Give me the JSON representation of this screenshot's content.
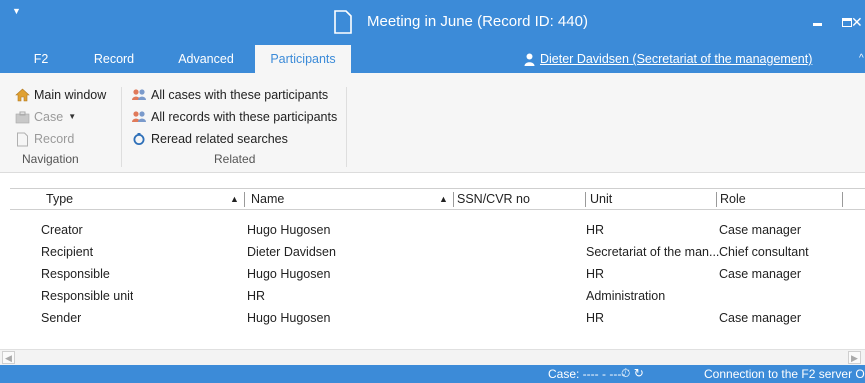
{
  "window": {
    "title": "Meeting in June (Record ID: 440)"
  },
  "tabs": [
    {
      "label": "F2"
    },
    {
      "label": "Record"
    },
    {
      "label": "Advanced"
    },
    {
      "label": "Participants",
      "active": true
    }
  ],
  "user": {
    "label": "Dieter Davidsen (Secretariat of the management)"
  },
  "ribbon": {
    "navigation": {
      "main_window": "Main window",
      "case": "Case",
      "record": "Record",
      "group_label": "Navigation"
    },
    "related": {
      "all_cases": "All cases with these participants",
      "all_records": "All records with these participants",
      "reread": "Reread related searches",
      "group_label": "Related"
    }
  },
  "grid": {
    "columns": [
      "Type",
      "Name",
      "SSN/CVR no",
      "Unit",
      "Role"
    ],
    "rows": [
      {
        "type": "Creator",
        "name": "Hugo Hugosen",
        "ssn": "",
        "unit": "HR",
        "role": "Case manager"
      },
      {
        "type": "Recipient",
        "name": "Dieter Davidsen",
        "ssn": "",
        "unit": "Secretariat of the man...",
        "role": "Chief consultant"
      },
      {
        "type": "Responsible",
        "name": "Hugo Hugosen",
        "ssn": "",
        "unit": "HR",
        "role": "Case manager"
      },
      {
        "type": "Responsible unit",
        "name": "HR",
        "ssn": "",
        "unit": "Administration",
        "role": ""
      },
      {
        "type": "Sender",
        "name": "Hugo Hugosen",
        "ssn": "",
        "unit": "HR",
        "role": "Case manager"
      }
    ]
  },
  "status": {
    "case": "Case: ---- - ----",
    "connection": "Connection to the F2 server O"
  },
  "colors": {
    "accent": "#3c8bd8",
    "ribbon_bg": "#f6f6f6"
  }
}
